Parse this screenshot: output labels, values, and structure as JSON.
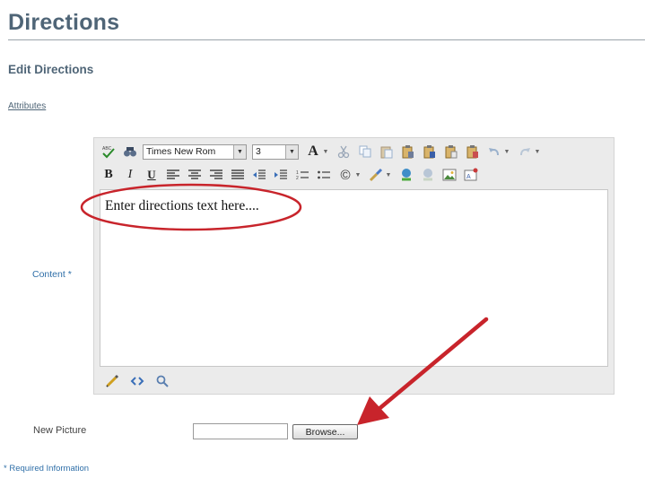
{
  "page": {
    "title": "Directions",
    "section_heading": "Edit Directions",
    "attributes_link": "Attributes"
  },
  "editor": {
    "label": "Content *",
    "font_family_value": "Times New Rom",
    "font_size_value": "3",
    "body_text": "Enter directions text here....",
    "toolbar_row_1": [
      "spellcheck-icon",
      "find-icon",
      "font-family-select",
      "font-size-select",
      "font-color-icon",
      "cut-icon",
      "copy-icon",
      "paste-icon",
      "paste-text-icon",
      "paste-word-icon",
      "paste-html-icon",
      "paste-special-icon",
      "undo-icon",
      "redo-icon"
    ],
    "toolbar_row_2": [
      "bold-button",
      "italic-button",
      "underline-button",
      "align-left-icon",
      "align-center-icon",
      "align-right-icon",
      "align-justify-icon",
      "outdent-icon",
      "indent-icon",
      "ordered-list-icon",
      "unordered-list-icon",
      "special-char-icon",
      "format-brush-icon",
      "insert-link-icon",
      "remove-link-icon",
      "insert-image-icon",
      "insert-symbol-icon"
    ],
    "bold_glyph": "B",
    "italic_glyph": "I",
    "underline_glyph": "U",
    "font_color_glyph": "A",
    "copyright_glyph": "©",
    "mode_bar": [
      "design-mode-icon",
      "html-mode-icon",
      "preview-mode-icon"
    ]
  },
  "picture": {
    "label": "New Picture",
    "browse_label": "Browse..."
  },
  "footer": {
    "required_note": "* Required Information"
  },
  "colors": {
    "title": "#4f6577",
    "link_label": "#2f6fa8",
    "annotation_red": "#c8242b"
  }
}
